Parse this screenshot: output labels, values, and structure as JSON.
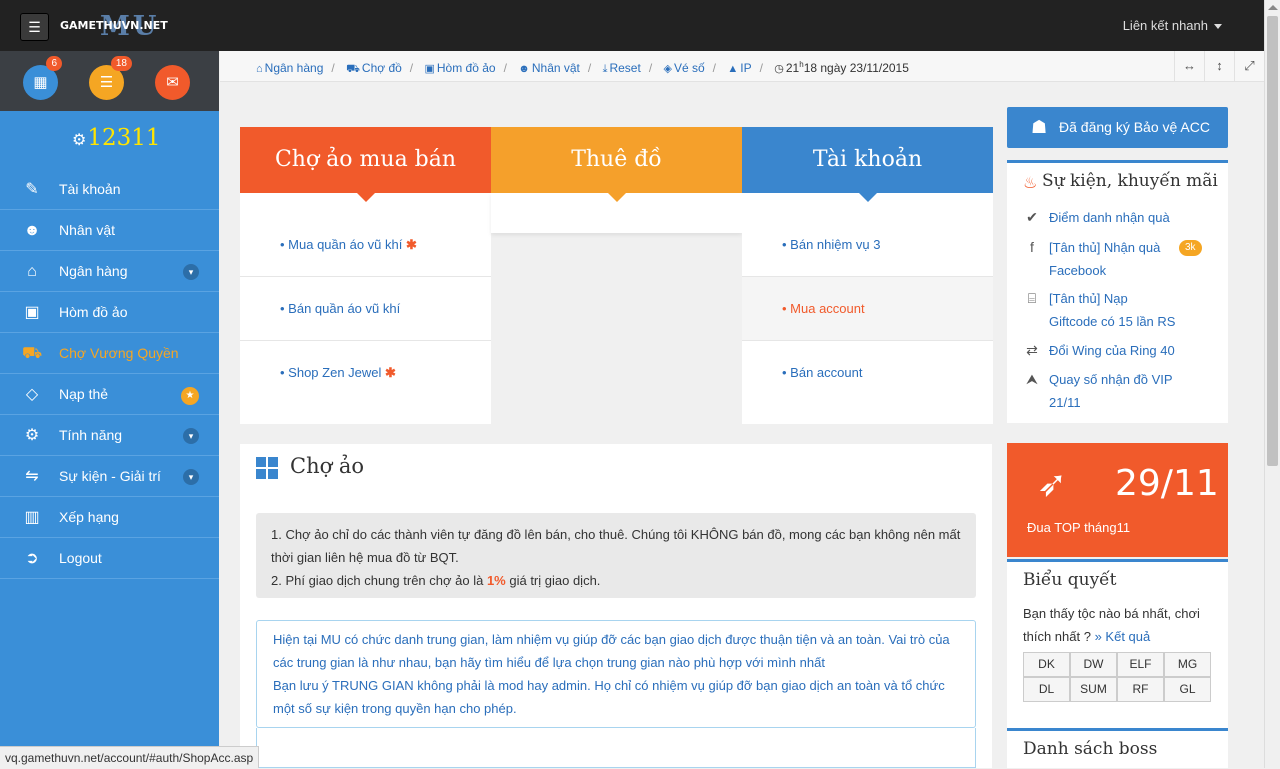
{
  "header": {
    "menu_icon": "hamburger-icon",
    "logo_text": "GAMETHUVN.NET",
    "logo_mu": "MU",
    "quick_link": "Liên kết nhanh"
  },
  "sidebar_top": {
    "calendar_badge": "6",
    "list_badge": "18"
  },
  "sidebar": {
    "points": "12311",
    "items": [
      {
        "label": "Tài khoản",
        "icon": "edit-icon"
      },
      {
        "label": "Nhân vật",
        "icon": "user-icon"
      },
      {
        "label": "Ngân hàng",
        "icon": "bank-icon"
      },
      {
        "label": "Hòm đồ ảo",
        "icon": "briefcase-icon"
      },
      {
        "label": "Chợ Vương Quyền",
        "icon": "cart-icon"
      },
      {
        "label": "Nạp thẻ",
        "icon": "diamond-icon"
      },
      {
        "label": "Tính năng",
        "icon": "gears-icon"
      },
      {
        "label": "Sự kiện - Giải trí",
        "icon": "exchange-icon"
      },
      {
        "label": "Xếp hạng",
        "icon": "bar-chart-icon"
      },
      {
        "label": "Logout",
        "icon": "logout-icon"
      }
    ]
  },
  "breadcrumb": {
    "items": [
      "Ngân hàng",
      "Chợ đồ",
      "Hòm đồ ảo",
      "Nhân vật",
      "Reset",
      "Vé số",
      "IP"
    ],
    "time": "21",
    "time_sup": "h",
    "time_rest": "18 ngày 23/11/2015"
  },
  "tiles": {
    "t1": {
      "title": "Chợ ảo mua bán",
      "rows": [
        "Mua quần áo vũ khí",
        "Bán quần áo vũ khí",
        "Shop Zen Jewel"
      ]
    },
    "t2": {
      "title": "Thuê đồ"
    },
    "t3": {
      "title": "Tài khoản",
      "rows": [
        "Bán nhiệm vụ 3",
        "Mua account",
        "Bán account"
      ]
    }
  },
  "panel": {
    "title": "Chợ ảo",
    "note_line1": "1. Chợ ảo chỉ do các thành viên tự đăng đồ lên bán, cho thuê. Chúng tôi KHÔNG bán đồ, mong các bạn không nên mất thời gian liên hệ mua đồ từ BQT.",
    "note_line2_pre": "2. Phí giao dịch chung trên chợ ảo là ",
    "note_line2_pct": "1%",
    "note_line2_post": " giá trị giao dịch.",
    "info_line1": "Hiện tại MU có chức danh trung gian, làm nhiệm vụ giúp đỡ các bạn giao dịch được thuận tiện và an toàn. Vai trò của các trung gian là như nhau, bạn hãy tìm hiểu để lựa chọn trung gian nào phù hợp với mình nhất",
    "info_line2": "Bạn lưu ý TRUNG GIAN không phải là mod hay admin. Họ chỉ có nhiệm vụ giúp đỡ bạn giao dịch an toàn và tổ chức một số sự kiện trong quyền hạn cho phép."
  },
  "right": {
    "protect": "Đã đăng ký Bảo vệ ACC",
    "events_title": "Sự kiện, khuyến mãi",
    "events": [
      {
        "text": "Điểm danh nhận quà",
        "icon": "check-circle-icon"
      },
      {
        "text": "[Tân thủ] Nhận quà Facebook",
        "icon": "facebook-icon",
        "badge": "3k"
      },
      {
        "text": "[Tân thủ] Nạp Giftcode có 15 lần RS",
        "icon": "gift-icon"
      },
      {
        "text": "Đổi Wing của Ring 40",
        "icon": "exchange-icon"
      },
      {
        "text": "Quay số nhận đồ VIP 21/11",
        "icon": "location-arrow-icon"
      }
    ],
    "top_date": "29/11",
    "top_label": "Đua TOP tháng11",
    "poll_title": "Biểu quyết",
    "poll_question": "Bạn thấy tộc nào bá nhất, chơi thích nhất ?",
    "poll_link": "» Kết quả",
    "poll_options": [
      "DK",
      "DW",
      "ELF",
      "MG",
      "DL",
      "SUM",
      "RF",
      "GL"
    ],
    "boss_title": "Danh sách boss"
  },
  "status_url": "vq.gamethuvn.net/account/#auth/ShopAcc.asp"
}
